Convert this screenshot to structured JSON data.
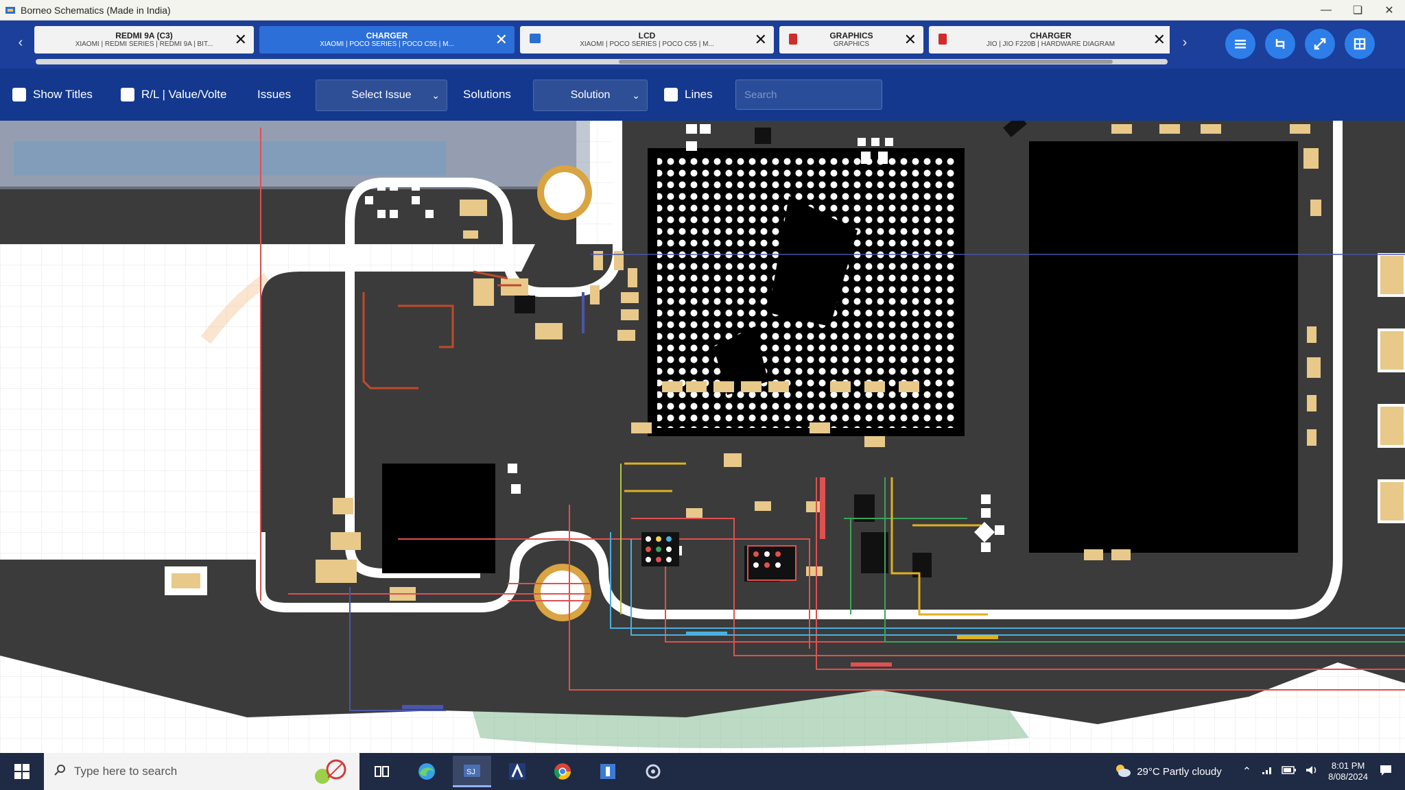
{
  "window": {
    "title": "Borneo Schematics (Made in India)",
    "controls": {
      "minimize": "—",
      "maximize": "❏",
      "close": "✕"
    }
  },
  "tabs": [
    {
      "title": "REDMI 9A (C3)",
      "subtitle": "XIAOMI | REDMI SERIES | REDMI 9A | BIT...",
      "close": "✕",
      "active": false,
      "icon": "none"
    },
    {
      "title": "CHARGER",
      "subtitle": "XIAOMI | POCO SERIES | POCO C55 | M...",
      "close": "✕",
      "active": true,
      "icon": "none"
    },
    {
      "title": "LCD",
      "subtitle": "XIAOMI | POCO SERIES | POCO C55 | M...",
      "close": "✕",
      "active": false,
      "icon": "image-icon"
    },
    {
      "title": "GRAPHICS",
      "subtitle": "GRAPHICS",
      "close": "✕",
      "active": false,
      "icon": "pdf-icon"
    },
    {
      "title": "CHARGER",
      "subtitle": "JIO | JIO F220B | HARDWARE DIAGRAM",
      "close": "✕",
      "active": false,
      "icon": "pdf-icon"
    }
  ],
  "tab_nav": {
    "prev": "‹",
    "next": "›"
  },
  "toolbar": {
    "show_titles": "Show Titles",
    "rl_value": "R/L | Value/Volte",
    "issues_label": "Issues",
    "select_issue": "Select Issue",
    "solutions_label": "Solutions",
    "solution_select": "Solution",
    "lines": "Lines",
    "search_placeholder": "Search"
  },
  "round_buttons": [
    "menu-icon",
    "rotate-icon",
    "flip-icon",
    "grid-icon"
  ],
  "taskbar": {
    "search_placeholder": "Type here to search",
    "weather": "29°C  Partly cloudy",
    "time": "8:01 PM",
    "date": "8/08/2024",
    "apps": [
      "task-view-icon",
      "edge-icon",
      "borneo-app-icon",
      "autocad-icon",
      "chrome-icon",
      "app-icon",
      "settings-icon"
    ]
  },
  "colors": {
    "titlebar": "#f4f4ee",
    "tabbar": "#1b3f9a",
    "toolbar": "#13388e",
    "board": "#3a3a3a",
    "pad": "#e8c98a",
    "accent": "#2d7ee8"
  }
}
